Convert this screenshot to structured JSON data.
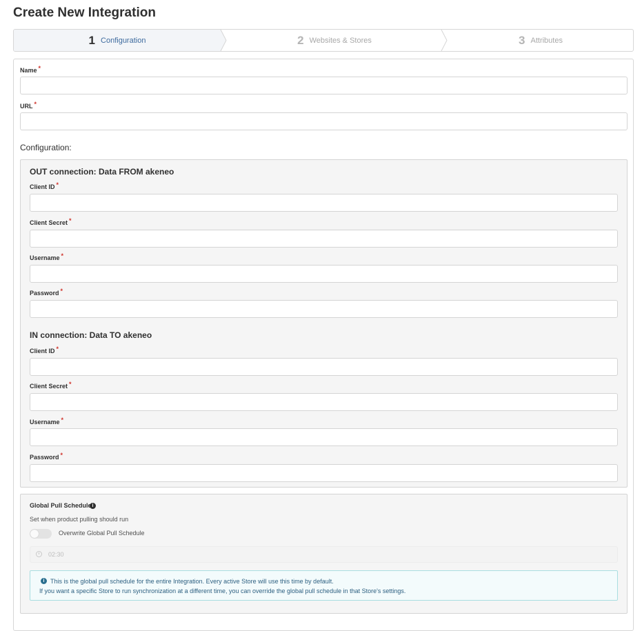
{
  "page": {
    "title": "Create New Integration"
  },
  "stepper": {
    "steps": [
      {
        "number": "1",
        "label": "Configuration",
        "state": "active"
      },
      {
        "number": "2",
        "label": "Websites & Stores",
        "state": "inactive"
      },
      {
        "number": "3",
        "label": "Attributes",
        "state": "inactive"
      }
    ]
  },
  "form": {
    "name": {
      "label": "Name",
      "required_mark": "*",
      "value": ""
    },
    "url": {
      "label": "URL",
      "required_mark": "*",
      "value": ""
    },
    "configuration_heading": "Configuration:",
    "out_connection": {
      "title": "OUT connection: Data FROM akeneo",
      "client_id": {
        "label": "Client ID",
        "required_mark": "*",
        "value": ""
      },
      "client_secret": {
        "label": "Client Secret",
        "required_mark": "*",
        "value": ""
      },
      "username": {
        "label": "Username",
        "required_mark": "*",
        "value": ""
      },
      "password": {
        "label": "Password",
        "required_mark": "*",
        "value": ""
      }
    },
    "in_connection": {
      "title": "IN connection: Data TO akeneo",
      "client_id": {
        "label": "Client ID",
        "required_mark": "*",
        "value": ""
      },
      "client_secret": {
        "label": "Client Secret",
        "required_mark": "*",
        "value": ""
      },
      "username": {
        "label": "Username",
        "required_mark": "*",
        "value": ""
      },
      "password": {
        "label": "Password",
        "required_mark": "*",
        "value": ""
      }
    },
    "schedule": {
      "title": "Global Pull Schedule",
      "info_icon": "info-circle-icon",
      "description": "Set when product pulling should run",
      "toggle_label": "Overwrite Global Pull Schedule",
      "toggle_on": false,
      "time_icon": "clock-icon",
      "time_value": "02:30",
      "notice_line1": "This is the global pull schedule for the entire Integration. Every active Store will use this time by default.",
      "notice_line2": "If you want a specific Store to run synchronization at a different time, you can override the global pull schedule in that Store's settings."
    }
  },
  "colors": {
    "accent": "#3d6a9e",
    "required": "#d0342c",
    "info_border": "#a8dde0",
    "info_text": "#2c5f80"
  }
}
